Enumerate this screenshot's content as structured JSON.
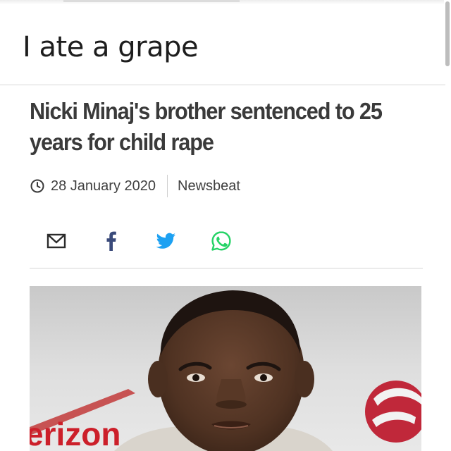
{
  "post": {
    "caption": "I ate a grape"
  },
  "article": {
    "headline": "Nicki Minaj's brother sentenced to 25 years for child rape",
    "date": "28 January 2020",
    "section": "Newsbeat",
    "date_icon": "clock-icon"
  },
  "share": {
    "buttons": [
      {
        "icon": "email-icon"
      },
      {
        "icon": "facebook-icon"
      },
      {
        "icon": "twitter-icon"
      },
      {
        "icon": "whatsapp-icon"
      }
    ]
  },
  "hero_image": {
    "backdrop_text": "erizon",
    "colors": {
      "backdrop": "#dcdcdc",
      "brand_red": "#cc1f2a",
      "skin": "#5a3b2a"
    }
  },
  "colors": {
    "twitter": "#1da1f2",
    "whatsapp": "#25d366",
    "text": "#3a3a3a"
  }
}
